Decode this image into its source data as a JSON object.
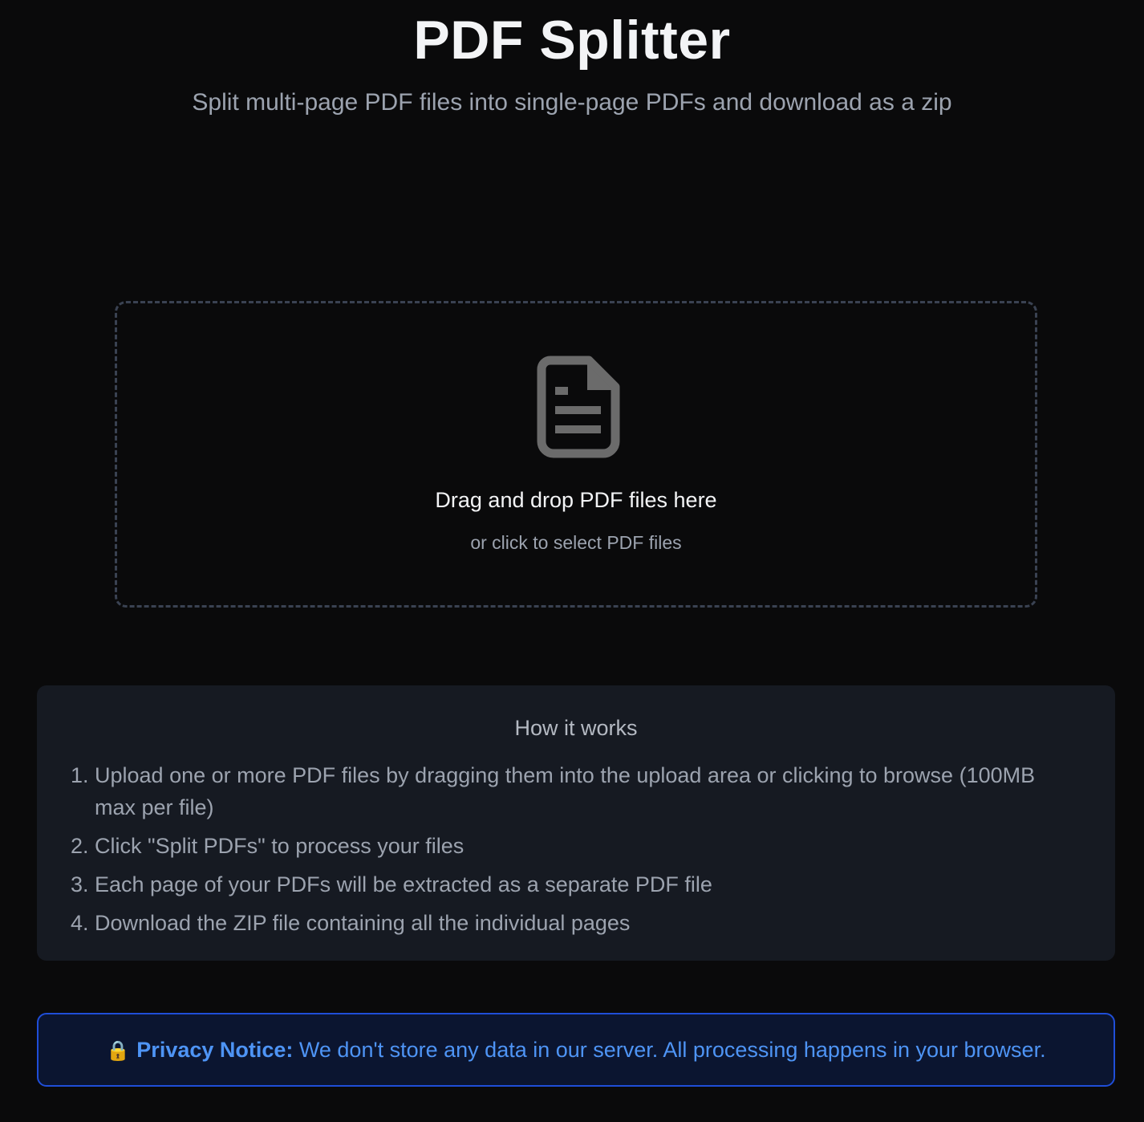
{
  "header": {
    "title": "PDF Splitter",
    "subtitle": "Split multi-page PDF files into single-page PDFs and download as a zip"
  },
  "dropzone": {
    "icon": "document-icon",
    "title": "Drag and drop PDF files here",
    "subtitle": "or click to select PDF files"
  },
  "how_it_works": {
    "title": "How it works",
    "steps": [
      {
        "num": "1.",
        "text": "Upload one or more PDF files by dragging them into the upload area or clicking to browse (100MB max per file)"
      },
      {
        "num": "2.",
        "text": "Click \"Split PDFs\" to process your files"
      },
      {
        "num": "3.",
        "text": "Each page of your PDFs will be extracted as a separate PDF file"
      },
      {
        "num": "4.",
        "text": "Download the ZIP file containing all the individual pages"
      }
    ]
  },
  "privacy": {
    "icon": "🔒",
    "label": "Privacy Notice:",
    "text": "We don't store any data in our server. All processing happens in your browser."
  },
  "colors": {
    "background": "#0a0a0b",
    "accent_blue": "#4e94f5",
    "card": "#161a22"
  }
}
